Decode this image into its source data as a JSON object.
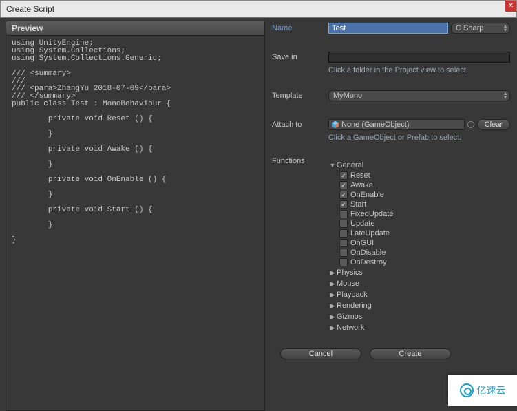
{
  "window_title": "Create Script",
  "preview": {
    "header": "Preview",
    "code": "using UnityEngine;\nusing System.Collections;\nusing System.Collections.Generic;\n\n/// <summary>\n/// \n/// <para>ZhangYu 2018-07-09</para>\n/// </summary>\npublic class Test : MonoBehaviour {\n\n\tprivate void Reset () {\n\t\t\n\t}\n\n\tprivate void Awake () {\n\t\t\n\t}\n\n\tprivate void OnEnable () {\n\t\t\n\t}\n\n\tprivate void Start () {\n\t\t\n\t}\n\n}"
  },
  "fields": {
    "name_label": "Name",
    "name_value": "Test",
    "language_label": "C Sharp",
    "savein_label": "Save in",
    "savein_value": "",
    "savein_hint": "Click a folder in the Project view to select.",
    "template_label": "Template",
    "template_value": "MyMono",
    "attach_label": "Attach to",
    "attach_value": "None (GameObject)",
    "clear_label": "Clear",
    "attach_hint": "Click a GameObject or Prefab to select.",
    "functions_label": "Functions"
  },
  "functions": {
    "groups": [
      {
        "label": "General",
        "expanded": true,
        "items": [
          {
            "label": "Reset",
            "checked": true
          },
          {
            "label": "Awake",
            "checked": true
          },
          {
            "label": "OnEnable",
            "checked": true
          },
          {
            "label": "Start",
            "checked": true
          },
          {
            "label": "FixedUpdate",
            "checked": false
          },
          {
            "label": "Update",
            "checked": false
          },
          {
            "label": "LateUpdate",
            "checked": false
          },
          {
            "label": "OnGUI",
            "checked": false
          },
          {
            "label": "OnDisable",
            "checked": false
          },
          {
            "label": "OnDestroy",
            "checked": false
          }
        ]
      },
      {
        "label": "Physics",
        "expanded": false,
        "items": []
      },
      {
        "label": "Mouse",
        "expanded": false,
        "items": []
      },
      {
        "label": "Playback",
        "expanded": false,
        "items": []
      },
      {
        "label": "Rendering",
        "expanded": false,
        "items": []
      },
      {
        "label": "Gizmos",
        "expanded": false,
        "items": []
      },
      {
        "label": "Network",
        "expanded": false,
        "items": []
      }
    ]
  },
  "buttons": {
    "cancel": "Cancel",
    "create": "Create"
  },
  "watermark": "亿速云"
}
